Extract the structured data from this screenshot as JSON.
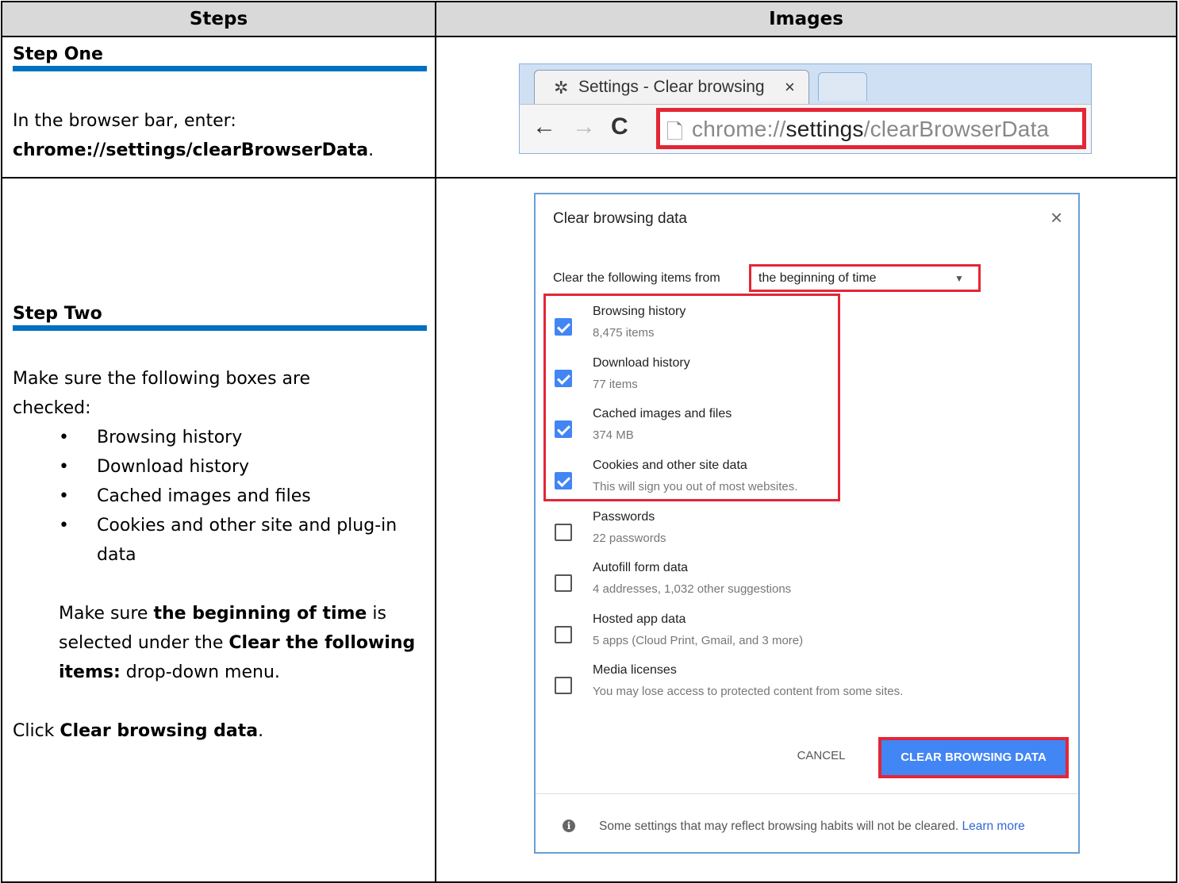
{
  "table": {
    "header_steps": "Steps",
    "header_images": "Images"
  },
  "step1": {
    "title": "Step One",
    "text_prefix": "In the browser bar, enter:",
    "url_bold": "chrome://settings/clearBrowserData",
    "text_suffix": "."
  },
  "browser": {
    "tab_title": "Settings - Clear browsing",
    "tab_close": "×",
    "url_scheme": "chrome://",
    "url_host": "settings",
    "url_path": "/clearBrowserData"
  },
  "step2": {
    "title": "Step Two",
    "intro": "Make sure the following boxes are checked:",
    "bullets": [
      "Browsing history",
      "Download history",
      "Cached images and files",
      "Cookies and other site and plug-in data"
    ],
    "para1_pre": "Make sure ",
    "para1_b1": "the beginning of time",
    "para1_mid": " is selected under the ",
    "para1_b2": "Clear the following items:",
    "para1_post": " drop-down menu.",
    "para2_pre": "Click ",
    "para2_b": "Clear browsing data",
    "para2_post": "."
  },
  "dialog": {
    "title": "Clear browsing data",
    "close": "×",
    "from_label": "Clear the following items from",
    "time_range": "the beginning of time",
    "items": [
      {
        "name": "Browsing history",
        "desc": "8,475 items",
        "checked": true
      },
      {
        "name": "Download history",
        "desc": "77 items",
        "checked": true
      },
      {
        "name": "Cached images and files",
        "desc": "374 MB",
        "checked": true
      },
      {
        "name": "Cookies and other site data",
        "desc": "This will sign you out of most websites.",
        "checked": true
      },
      {
        "name": "Passwords",
        "desc": "22 passwords",
        "checked": false
      },
      {
        "name": "Autofill form data",
        "desc": "4 addresses, 1,032 other suggestions",
        "checked": false
      },
      {
        "name": "Hosted app data",
        "desc": "5 apps (Cloud Print, Gmail, and 3 more)",
        "checked": false
      },
      {
        "name": "Media licenses",
        "desc": "You may lose access to protected content from some sites.",
        "checked": false
      }
    ],
    "cancel_label": "CANCEL",
    "clear_label": "CLEAR BROWSING DATA",
    "info_text": "Some settings that may reflect browsing habits will not be cleared.",
    "info_link": "Learn more"
  },
  "colors": {
    "highlight_red": "#e32636",
    "accent_blue": "#4285f4",
    "rule_blue": "#0070c0",
    "header_gray": "#d9d9d9"
  }
}
